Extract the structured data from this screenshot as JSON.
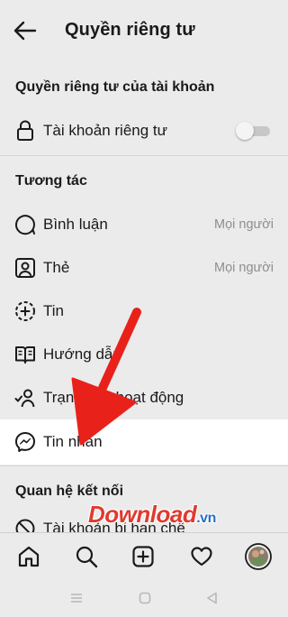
{
  "header": {
    "title": "Quyền riêng tư"
  },
  "account_section": {
    "title": "Quyền riêng tư của tài khoản",
    "private_account": {
      "label": "Tài khoản riêng tư",
      "enabled": false
    }
  },
  "interactions": {
    "title": "Tương tác",
    "items": [
      {
        "label": "Bình luận",
        "value": "Mọi người",
        "icon": "comment-icon"
      },
      {
        "label": "Thẻ",
        "value": "Mọi người",
        "icon": "tag-icon"
      },
      {
        "label": "Tin",
        "value": "",
        "icon": "story-icon"
      },
      {
        "label": "Hướng dẫn",
        "value": "",
        "icon": "guide-icon"
      },
      {
        "label": "Trạng thái hoạt động",
        "value": "",
        "icon": "activity-status-icon"
      },
      {
        "label": "Tin nhắn",
        "value": "",
        "icon": "messenger-icon"
      }
    ]
  },
  "connections": {
    "title": "Quan hệ kết nối",
    "items": [
      {
        "label": "Tài khoản bị hạn chế",
        "icon": "restricted-icon"
      }
    ]
  },
  "watermark": {
    "text": "Download",
    "suffix": ".vn"
  },
  "colors": {
    "background": "#ebebeb",
    "highlight": "#ffffff",
    "arrow": "#e8221b",
    "muted_text": "#8e8e8e"
  }
}
